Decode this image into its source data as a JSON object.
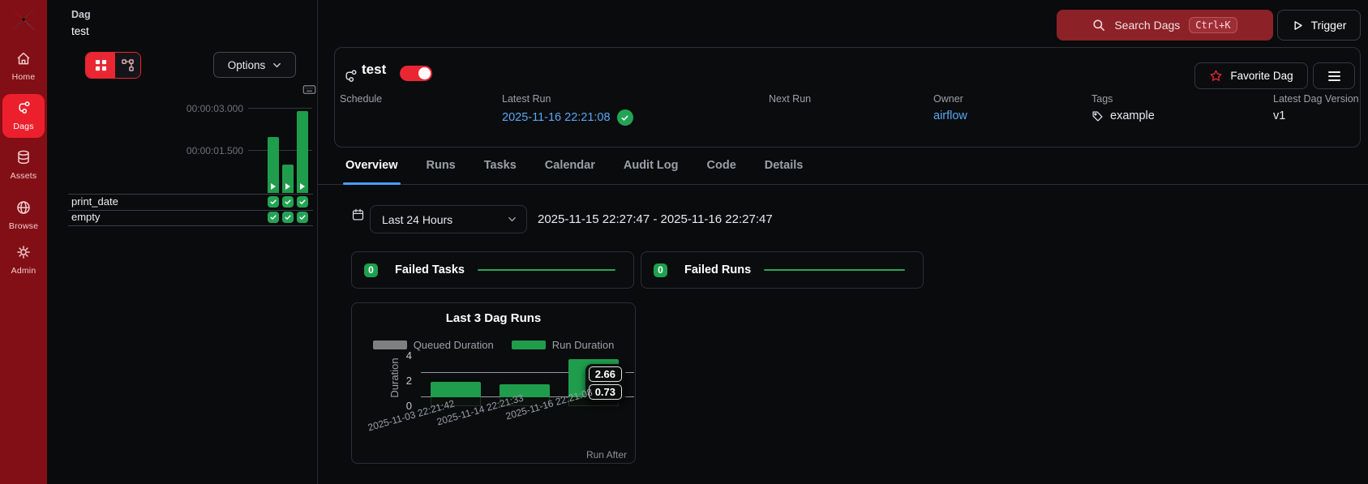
{
  "sidebar": {
    "items": [
      {
        "label": "Home",
        "active": false
      },
      {
        "label": "Dags",
        "active": true
      },
      {
        "label": "Assets",
        "active": false
      },
      {
        "label": "Browse",
        "active": false
      },
      {
        "label": "Admin",
        "active": false
      }
    ]
  },
  "breadcrumb": {
    "section": "Dag",
    "dag_name": "test"
  },
  "left_panel": {
    "options_label": "Options",
    "gantt": {
      "tick_labels": [
        "00:00:03.000",
        "00:00:01.500"
      ],
      "tick_seconds": [
        3.0,
        1.5
      ],
      "run_durations_seconds": [
        2.0,
        1.0,
        2.9
      ]
    },
    "task_rows": [
      {
        "name": "print_date",
        "statuses": [
          "success",
          "success",
          "success"
        ]
      },
      {
        "name": "empty",
        "statuses": [
          "success",
          "success",
          "success"
        ]
      }
    ]
  },
  "topbar": {
    "search_label": "Search Dags",
    "search_shortcut": "Ctrl+K",
    "trigger_label": "Trigger"
  },
  "dag_header": {
    "title": "test",
    "enabled": true,
    "favorite_label": "Favorite Dag",
    "fields": [
      {
        "label": "Schedule",
        "value": ""
      },
      {
        "label": "Latest Run",
        "value": "2025-11-16 22:21:08",
        "status": "success"
      },
      {
        "label": "Next Run",
        "value": ""
      },
      {
        "label": "Owner",
        "value": "airflow"
      },
      {
        "label": "Tags",
        "value": "example"
      },
      {
        "label": "Latest Dag Version",
        "value": "v1"
      }
    ]
  },
  "tabs": {
    "active": "Overview",
    "items": [
      {
        "label": "Overview"
      },
      {
        "label": "Runs"
      },
      {
        "label": "Tasks"
      },
      {
        "label": "Calendar"
      },
      {
        "label": "Audit Log"
      },
      {
        "label": "Code"
      },
      {
        "label": "Details"
      }
    ]
  },
  "filter_bar": {
    "selected_range": "Last 24 Hours",
    "range_text": "2025-11-15 22:27:47 - 2025-11-16 22:27:47"
  },
  "summary_cards": [
    {
      "count": "0",
      "label": "Failed Tasks"
    },
    {
      "count": "0",
      "label": "Failed Runs"
    }
  ],
  "chart_data": {
    "type": "bar",
    "title": "Last 3 Dag Runs",
    "stacked": true,
    "categories": [
      "2025-11-03 22:21:42",
      "2025-11-14 22:21:33",
      "2025-11-16 22:21:08"
    ],
    "series": [
      {
        "name": "Queued Duration",
        "color": "#808080",
        "values": [
          0.73,
          0.73,
          0.73
        ]
      },
      {
        "name": "Run Duration",
        "color": "#1f9d4d",
        "values": [
          1.25,
          1.0,
          3.0
        ]
      }
    ],
    "reference_lines": [
      {
        "label": "2.66",
        "value": 2.66
      },
      {
        "label": "0.73",
        "value": 0.73
      }
    ],
    "ylabel": "Duration",
    "xlabel": "Run After",
    "yticks": [
      0,
      2,
      4
    ],
    "ylim": [
      0,
      4.6
    ],
    "legend_position": "top",
    "grid": false
  },
  "colors": {
    "sidebar_bg": "#830f16",
    "accent_red": "#e92732",
    "search_button_bg": "#8c2127",
    "success_green": "#1f9d4d",
    "link_blue": "#59a7f2",
    "tab_underline_blue": "#4a9eff",
    "queued_gray": "#808080"
  }
}
